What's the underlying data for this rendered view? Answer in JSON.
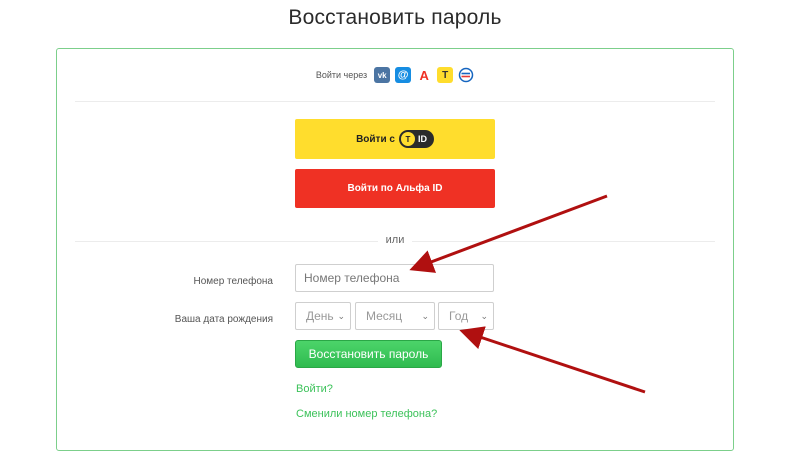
{
  "page": {
    "title": "Восстановить пароль"
  },
  "social": {
    "label": "Войти через",
    "icons": [
      {
        "name": "vk-icon",
        "glyph": "vk"
      },
      {
        "name": "mail-icon",
        "glyph": "@"
      },
      {
        "name": "alfa-icon",
        "glyph": "А"
      },
      {
        "name": "tid-icon",
        "glyph": "T"
      },
      {
        "name": "gosuslugi-icon",
        "glyph": ""
      }
    ]
  },
  "buttons": {
    "tid_prefix": "Войти с",
    "tid_badge": "ID",
    "alfa": "Войти по Альфа ID",
    "restore": "Восстановить пароль"
  },
  "divider_text": "или",
  "form": {
    "phone_label": "Номер телефона",
    "phone_placeholder": "Номер телефона",
    "dob_label": "Ваша дата рождения",
    "day": "День",
    "month": "Месяц",
    "year": "Год"
  },
  "links": {
    "login": "Войти?",
    "changed_phone": "Сменили номер телефона?"
  },
  "colors": {
    "accent_green": "#3cc25a",
    "tid_yellow": "#ffdd2d",
    "alfa_red": "#ef3124",
    "arrow_red": "#b01010"
  }
}
